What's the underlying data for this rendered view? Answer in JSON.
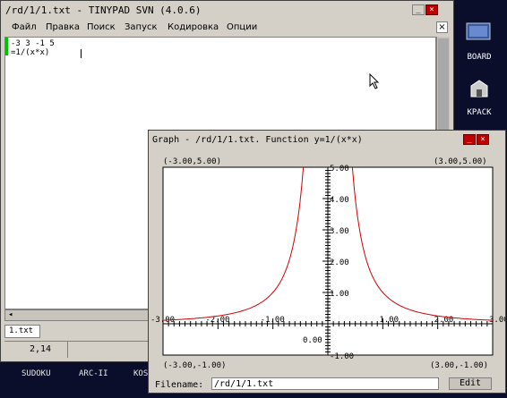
{
  "desktop": {
    "icons": [
      {
        "label": "BOARD",
        "icon": "board-icon"
      },
      {
        "label": "KPACK",
        "icon": "kpack-icon"
      }
    ],
    "taskbar": [
      "SUDOKU",
      "ARC-II",
      "KOS"
    ]
  },
  "tinypad": {
    "title": "/rd/1/1.txt - TINYPAD SVN (4.0.6)",
    "menu": [
      "Файл",
      "Правка",
      "Поиск",
      "Запуск",
      "Кодировка",
      "Опции"
    ],
    "close_x": "×",
    "lines": [
      "-3 3 -1 5",
      "=1/(x*x)"
    ],
    "tab": "1.txt",
    "status_pos": "2,14"
  },
  "graph": {
    "title": "Graph - /rd/1/1.txt. Function y=1/(x*x)",
    "corners": {
      "top_left": "(-3.00,5.00)",
      "top_right": "(3.00,5.00)",
      "bottom_left": "(-3.00,-1.00)",
      "bottom_right": "(3.00,-1.00)"
    },
    "filename_label": "Filename:",
    "filename_value": "/rd/1/1.txt",
    "edit_label": "Edit"
  },
  "chart_data": {
    "type": "line",
    "function": "y=1/(x*x)",
    "xlim": [
      -3,
      3
    ],
    "ylim": [
      -1,
      5
    ],
    "x_ticks": [
      "-3.00",
      "-2.00",
      "-1.00",
      "0.00",
      "1.00",
      "2.00",
      "3.00"
    ],
    "y_ticks": [
      "5.00",
      "4.00",
      "3.00",
      "2.00",
      "1.00",
      "-1.00"
    ],
    "line_color": "#d00000"
  },
  "colors": {
    "desktop": "#0a0e2a",
    "window": "#d4d0c8",
    "close": "#c00000",
    "gutter": "#00c000"
  }
}
